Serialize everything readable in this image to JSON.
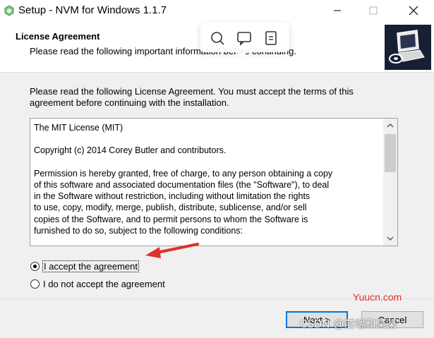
{
  "window": {
    "title": "Setup - NVM for Windows 1.1.7",
    "minimize_icon": "minimize-icon",
    "maximize_icon": "maximize-icon",
    "close_icon": "close-icon"
  },
  "header": {
    "title": "License Agreement",
    "subtitle": "Please read the following important information before continuing."
  },
  "floating_toolbar": {
    "icons": [
      "search-icon",
      "comment-icon",
      "note-icon"
    ]
  },
  "body": {
    "intro": "Please read the following License Agreement. You must accept the terms of this agreement before continuing with the installation.",
    "license_lines": {
      "p1": "The MIT License (MIT)",
      "p2": "Copyright (c) 2014 Corey Butler and contributors.",
      "p3_l1": "Permission is hereby granted, free of charge, to any person obtaining a copy",
      "p3_l2": "of this software and associated documentation files (the \"Software\"), to deal",
      "p3_l3": "in the Software without restriction, including without limitation the rights",
      "p3_l4": "to use, copy, modify, merge, publish, distribute, sublicense, and/or sell",
      "p3_l5": "copies of the Software, and to permit persons to whom the Software is",
      "p3_l6": "furnished to do so, subject to the following conditions:"
    }
  },
  "options": {
    "accept": {
      "label": "I accept the agreement",
      "checked": true
    },
    "decline": {
      "label": "I do not accept the agreement",
      "checked": false
    }
  },
  "buttons": {
    "next": "Next >",
    "cancel": "Cancel"
  },
  "watermarks": {
    "site": "Yuucn.com",
    "csdn": "CSDN @前端和某某"
  },
  "colors": {
    "accent": "#0078d7",
    "annotation_arrow": "#e0302a",
    "wizard_image_bg": "#171f33"
  }
}
